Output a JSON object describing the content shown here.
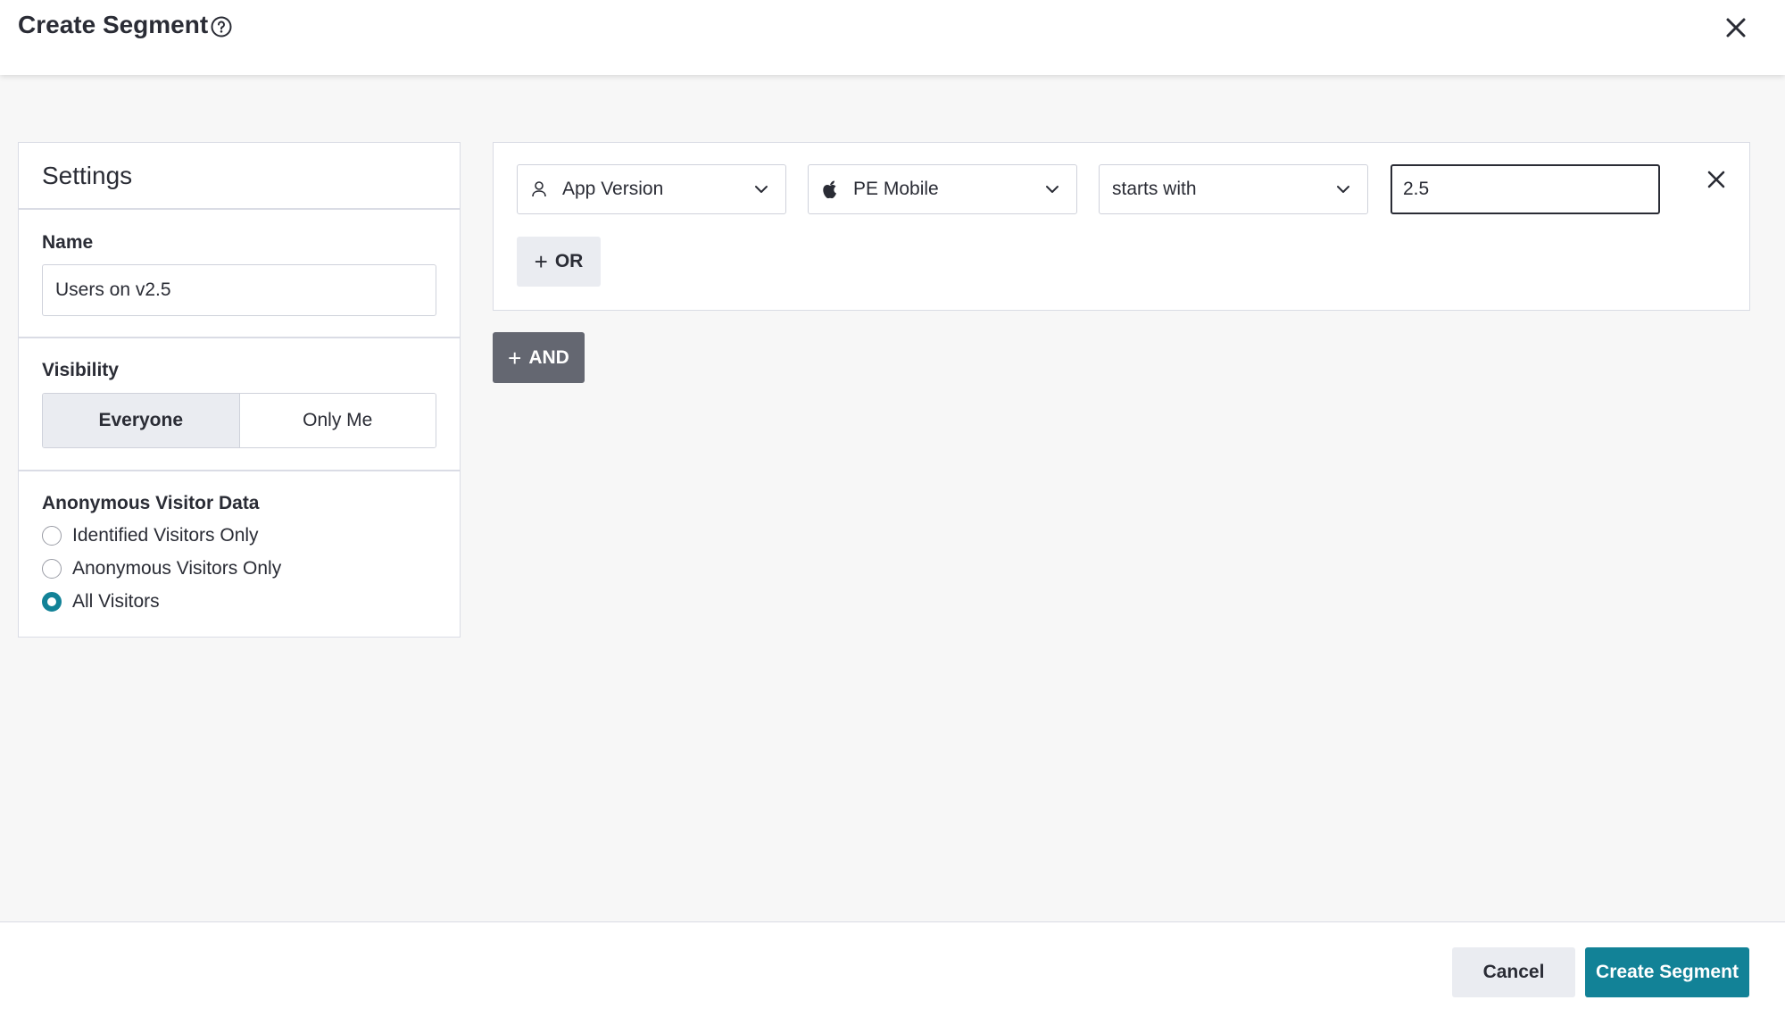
{
  "header": {
    "title": "Create Segment",
    "help_icon": "help-circle-icon",
    "close_icon": "close-icon"
  },
  "settings": {
    "title": "Settings",
    "name_label": "Name",
    "name_value": "Users on v2.5",
    "visibility_label": "Visibility",
    "visibility_options": [
      "Everyone",
      "Only Me"
    ],
    "visibility_selected": "Everyone",
    "anon_label": "Anonymous Visitor Data",
    "anon_options": [
      "Identified Visitors Only",
      "Anonymous Visitors Only",
      "All Visitors"
    ],
    "anon_selected": "All Visitors"
  },
  "rule": {
    "field": "App Version",
    "field_icon": "user-icon",
    "app": "PE Mobile",
    "app_icon": "apple-icon",
    "operator": "starts with",
    "value": "2.5",
    "or_label": "OR",
    "remove_icon": "close-icon"
  },
  "and_label": "AND",
  "footer": {
    "cancel_label": "Cancel",
    "create_label": "Create Segment"
  },
  "colors": {
    "accent": "#128297",
    "and_button": "#646771",
    "background": "#f7f7f7"
  }
}
